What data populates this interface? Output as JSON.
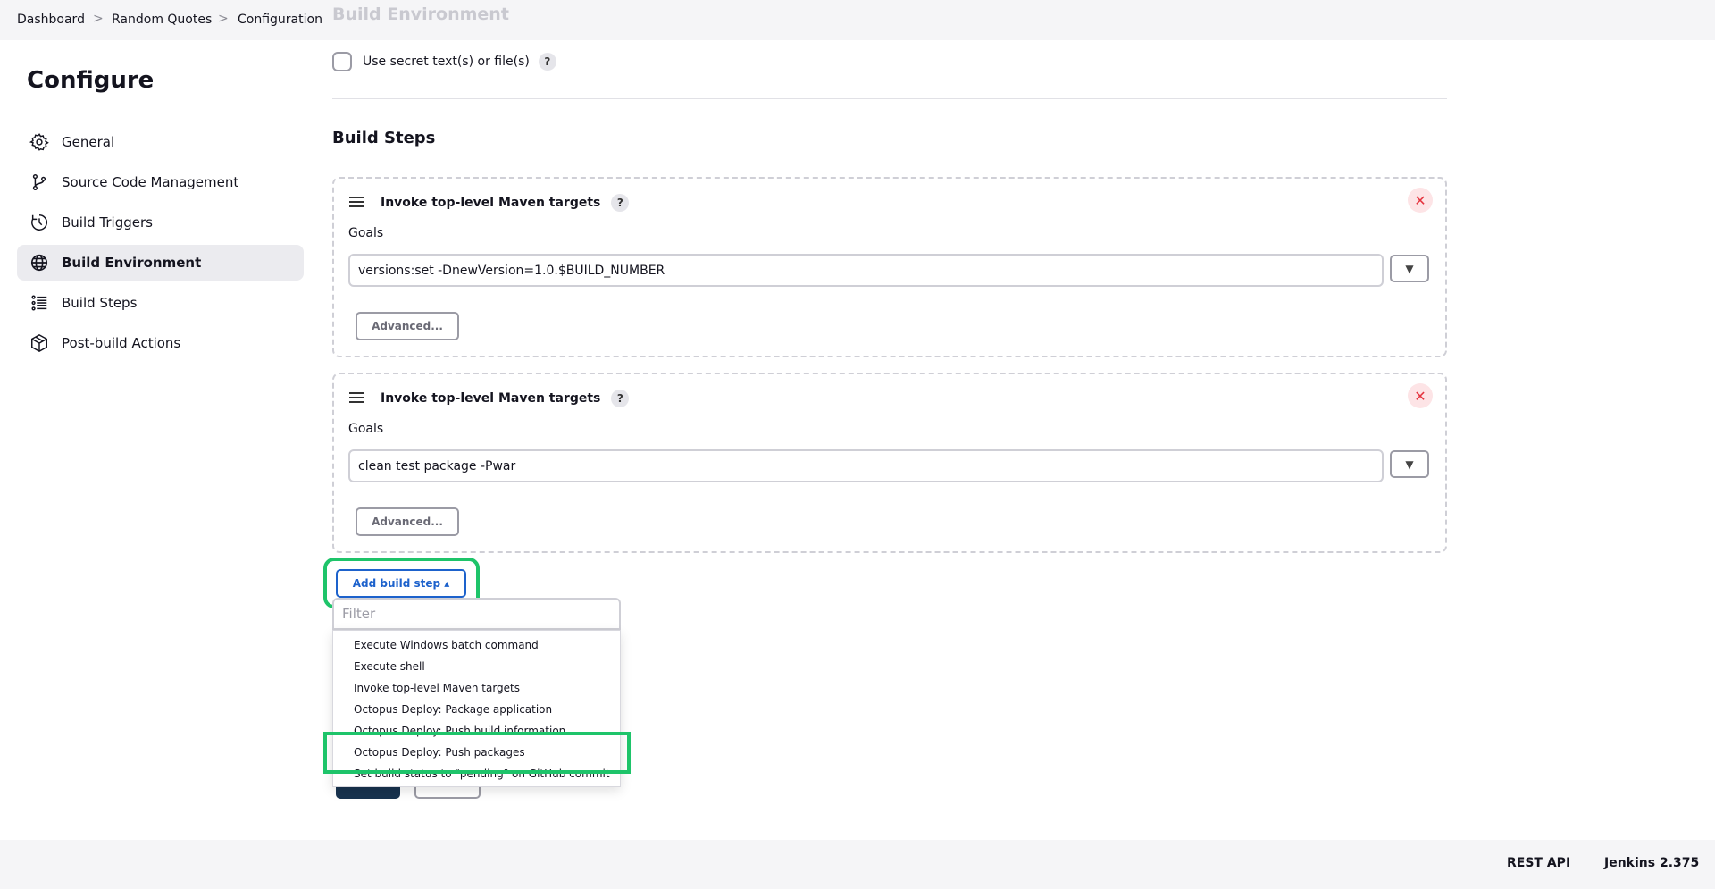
{
  "breadcrumb": {
    "items": [
      "Dashboard",
      "Random Quotes",
      "Configuration"
    ],
    "separator": ">"
  },
  "ghost_heading": "Build Environment",
  "page_title": "Configure",
  "sidebar": {
    "items": [
      {
        "label": "General",
        "icon": "gear-icon"
      },
      {
        "label": "Source Code Management",
        "icon": "branch-icon"
      },
      {
        "label": "Build Triggers",
        "icon": "clock-icon"
      },
      {
        "label": "Build Environment",
        "icon": "globe-icon",
        "active": true
      },
      {
        "label": "Build Steps",
        "icon": "list-icon"
      },
      {
        "label": "Post-build Actions",
        "icon": "package-icon"
      }
    ]
  },
  "build_environment": {
    "secret_label": "Use secret text(s) or file(s)",
    "secret_checked": false
  },
  "help_glyph": "?",
  "build_steps": {
    "title": "Build Steps",
    "steps": [
      {
        "title": "Invoke top-level Maven targets",
        "goals_label": "Goals",
        "goals_value": "versions:set -DnewVersion=1.0.$BUILD_NUMBER",
        "advanced_label": "Advanced...",
        "close_glyph": "✕",
        "expand_glyph": "▼"
      },
      {
        "title": "Invoke top-level Maven targets",
        "goals_label": "Goals",
        "goals_value": "clean test package -Pwar",
        "advanced_label": "Advanced...",
        "close_glyph": "✕",
        "expand_glyph": "▼"
      }
    ],
    "add_label": "Add build step ▴"
  },
  "dropdown": {
    "filter_placeholder": "Filter",
    "items": [
      "Execute Windows batch command",
      "Execute shell",
      "Invoke top-level Maven targets",
      "Octopus Deploy: Package application",
      "Octopus Deploy: Push build information",
      "Octopus Deploy: Push packages",
      "Set build status to \"pending\" on GitHub commit"
    ],
    "highlighted_index": 5
  },
  "footer": {
    "rest_api": "REST API",
    "version": "Jenkins 2.375"
  },
  "colors": {
    "highlight": "#1ec46a",
    "primary": "#1d62cc",
    "danger": "#e5343f",
    "save": "#18334f"
  }
}
